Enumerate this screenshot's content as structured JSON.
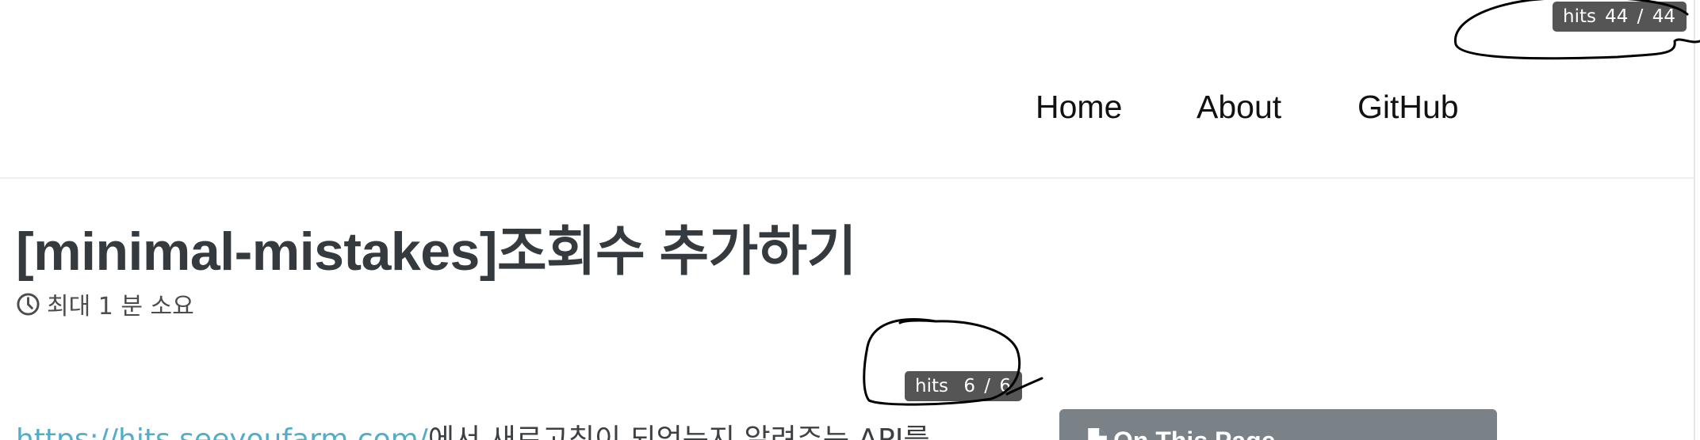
{
  "hits_badges": {
    "site": {
      "label": "hits",
      "count": "44 / 44"
    },
    "post": {
      "label": "hits",
      "count": "6 / 6"
    }
  },
  "nav": {
    "items": [
      {
        "label": "Home"
      },
      {
        "label": "About"
      },
      {
        "label": "GitHub"
      }
    ]
  },
  "post": {
    "title": "[minimal-mistakes]조회수 추가하기",
    "read_time": "최대 1 분 소요",
    "body_link": "https://hits.seeyoufarm.com/",
    "body_text": "에서 새로고침이 되었는지 알려주는 API를"
  },
  "toc": {
    "title": "On This Page",
    "icon": "file-icon"
  },
  "colors": {
    "badge_bg": "#555555",
    "link": "#52adc8",
    "title": "#353a3f",
    "toc_header_bg": "#7a8288",
    "annotation_ink": "#000000"
  }
}
